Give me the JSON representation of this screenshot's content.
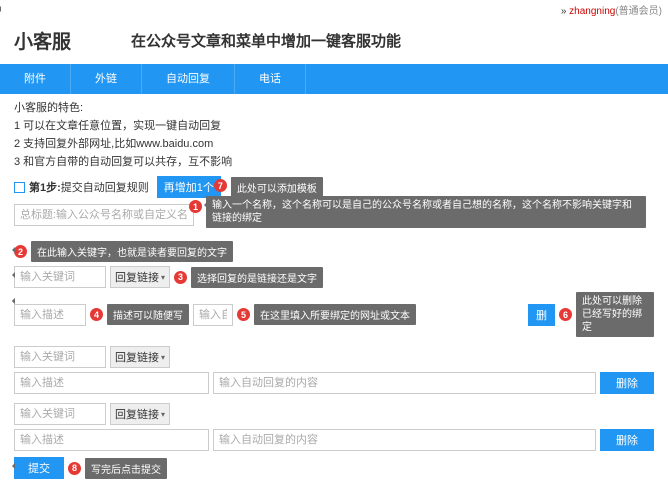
{
  "topbar": {
    "prefix": "» ",
    "username": "zhangning",
    "memberType": "(普通会员)"
  },
  "header": {
    "logo": "小客服",
    "slogan": "在公众号文章和菜单中增加一键客服功能"
  },
  "nav": [
    {
      "label": "附件"
    },
    {
      "label": "外链"
    },
    {
      "label": "自动回复"
    },
    {
      "label": "电话"
    }
  ],
  "intro": {
    "l0": "小客服的特色:",
    "l1": "1 可以在文章任意位置，实现一键自动回复",
    "l2": "2 支持回复外部网址,比如www.baidu.com",
    "l3": "3 和官方自带的自动回复可以共存，互不影响"
  },
  "step": {
    "prefix": "第1步:",
    "text": " 提交自动回复规则",
    "addBtn": "再增加1个"
  },
  "placeholders": {
    "title": "总标题:输入公众号名称或自定义名",
    "keyword": "输入关键词",
    "desc": "输入描述",
    "auto": "输入自动回复的内容",
    "autoShort": "输入自"
  },
  "select": {
    "replyLink": "回复链接"
  },
  "buttons": {
    "delete": "删除",
    "deleteShort": "删",
    "submit": "提交"
  },
  "tips": {
    "t1": "输入一个名称，这个名称可以是自己的公众号名称或者自己想的名称，这个名称不影响关键字和链接的绑定",
    "t2": "在此输入关键字，也就是读者要回复的文字",
    "t3": "选择回复的是链接还是文字",
    "t4": "描述可以随便写",
    "t5": "在这里填入所要绑定的网址或文本",
    "t6": "此处可以删除已经写好的绑定",
    "t7": "此处可以添加模板",
    "t8": "写完后点击提交"
  },
  "badges": {
    "b1": "1",
    "b2": "2",
    "b3": "3",
    "b4": "4",
    "b5": "5",
    "b6": "6",
    "b7": "7",
    "b8": "8"
  },
  "watermark": ""
}
